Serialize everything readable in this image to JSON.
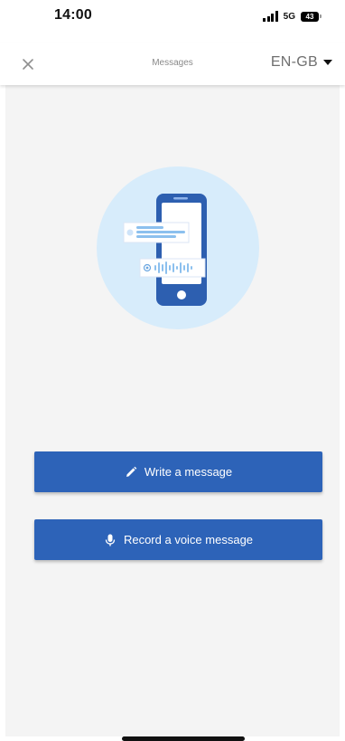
{
  "status_bar": {
    "time": "14:00",
    "network": "5G",
    "battery": "43"
  },
  "header": {
    "title": "Messages",
    "language": "EN-GB"
  },
  "illustration": {
    "icon": "phone-messages-illustration"
  },
  "actions": {
    "write_label": "Write a message",
    "voice_label": "Record a voice message"
  },
  "colors": {
    "primary": "#2d63b8",
    "background": "#f4f4f4",
    "illustration_circle": "#d7ecfb",
    "phone": "#2d5fb0"
  },
  "icons": {
    "close": "close-icon",
    "caret": "chevron-down-icon",
    "write": "pencil-icon",
    "voice": "microphone-icon"
  }
}
